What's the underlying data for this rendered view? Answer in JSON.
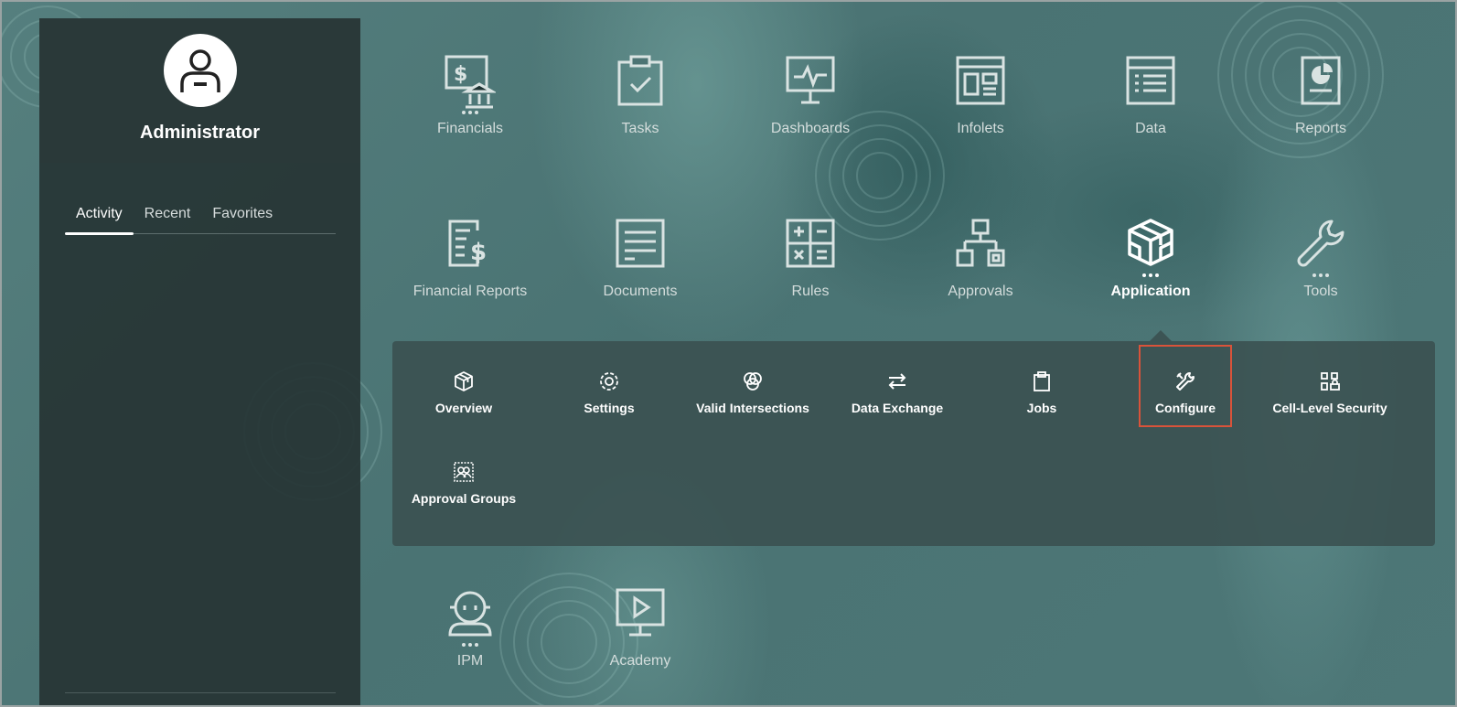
{
  "user": {
    "name": "Administrator"
  },
  "sidebar_tabs": [
    {
      "label": "Activity",
      "active": true
    },
    {
      "label": "Recent",
      "active": false
    },
    {
      "label": "Favorites",
      "active": false
    }
  ],
  "tiles": [
    {
      "label": "Financials",
      "icon": "financials-icon",
      "has_menu": true
    },
    {
      "label": "Tasks",
      "icon": "tasks-icon",
      "has_menu": false
    },
    {
      "label": "Dashboards",
      "icon": "dashboards-icon",
      "has_menu": false
    },
    {
      "label": "Infolets",
      "icon": "infolets-icon",
      "has_menu": false
    },
    {
      "label": "Data",
      "icon": "data-icon",
      "has_menu": false
    },
    {
      "label": "Reports",
      "icon": "reports-icon",
      "has_menu": false
    },
    {
      "label": "Financial Reports",
      "icon": "financial-reports-icon",
      "has_menu": false
    },
    {
      "label": "Documents",
      "icon": "documents-icon",
      "has_menu": false
    },
    {
      "label": "Rules",
      "icon": "rules-icon",
      "has_menu": false
    },
    {
      "label": "Approvals",
      "icon": "approvals-icon",
      "has_menu": false
    },
    {
      "label": "Application",
      "icon": "application-icon",
      "has_menu": true,
      "active": true
    },
    {
      "label": "Tools",
      "icon": "tools-icon",
      "has_menu": true
    },
    {
      "label": "IPM",
      "icon": "ipm-icon",
      "has_menu": true
    },
    {
      "label": "Academy",
      "icon": "academy-icon",
      "has_menu": false
    }
  ],
  "application_menu": [
    {
      "label": "Overview",
      "icon": "cube-icon"
    },
    {
      "label": "Settings",
      "icon": "gear-icon"
    },
    {
      "label": "Valid Intersections",
      "icon": "intersections-icon"
    },
    {
      "label": "Data Exchange",
      "icon": "exchange-arrows-icon"
    },
    {
      "label": "Jobs",
      "icon": "clipboard-icon"
    },
    {
      "label": "Configure",
      "icon": "configure-tools-icon",
      "selected": true
    },
    {
      "label": "Cell-Level Security",
      "icon": "cell-security-icon"
    },
    {
      "label": "Approval Groups",
      "icon": "approval-groups-icon"
    }
  ],
  "colors": {
    "highlight": "#d9533a",
    "icon_stroke": "#d9e3e2",
    "panel": "#3a5050"
  }
}
